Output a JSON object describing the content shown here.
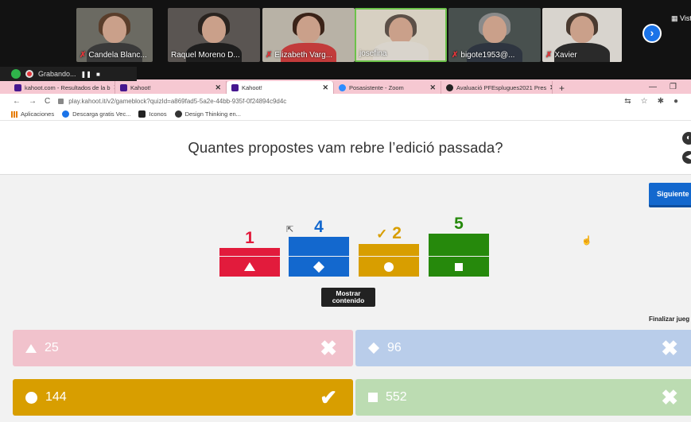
{
  "zoom": {
    "participants": [
      {
        "name": "Candela Blanc...",
        "muted": true
      },
      {
        "name": "Raquel Moreno D...",
        "muted": false
      },
      {
        "name": "Elizabeth Varg...",
        "muted": true
      },
      {
        "name": "josefina",
        "muted": false
      },
      {
        "name": "bigote1953@...",
        "muted": true
      },
      {
        "name": "Xavier",
        "muted": true
      }
    ],
    "view_label": "Vist",
    "recording_label": "Grabando...",
    "pause_glyph": "❚❚",
    "stop_glyph": "■"
  },
  "browser": {
    "tabs": [
      {
        "label": "kahoot.com - Resultados de la b",
        "close": "✕"
      },
      {
        "label": "Kahoot!",
        "close": "✕"
      },
      {
        "label": "Kahoot!",
        "close": "✕"
      },
      {
        "label": "Posasistente - Zoom",
        "close": "✕"
      },
      {
        "label": "Avaluació PFEsplugues2021 Pres",
        "close": "✕"
      }
    ],
    "url": "play.kahoot.it/v2/gameblock?quizId=a869fad5-5a2e-44bb-935f-0f24894c9d4c",
    "bookmarks": [
      "Aplicaciones",
      "Descarga gratis Vec...",
      "Iconos",
      "Design Thinking en..."
    ]
  },
  "kahoot": {
    "question": "Quantes propostes vam rebre l’edició passada?",
    "next_label": "Siguiente",
    "show_content_line1": "Mostrar",
    "show_content_line2": "contenido",
    "finish_label": "Finalizar jueg",
    "results": [
      {
        "count": "1",
        "shape": "triangle",
        "color": "#e21b3c",
        "correct": false
      },
      {
        "count": "4",
        "shape": "diamond",
        "color": "#1368ce",
        "correct": false
      },
      {
        "count": "2",
        "shape": "circle",
        "color": "#d89e00",
        "correct": true,
        "check": "✓"
      },
      {
        "count": "5",
        "shape": "square",
        "color": "#26890c",
        "correct": false
      }
    ],
    "answers": [
      {
        "text": "25",
        "shape": "triangle",
        "color": "#f1c2cc",
        "mark": "✖"
      },
      {
        "text": "96",
        "shape": "diamond",
        "color": "#b9cdea",
        "mark": "✖"
      },
      {
        "text": "144",
        "shape": "circle",
        "color": "#d89e00",
        "mark": "✔"
      },
      {
        "text": "552",
        "shape": "square",
        "color": "#bcdcb2",
        "mark": "✖"
      }
    ]
  }
}
